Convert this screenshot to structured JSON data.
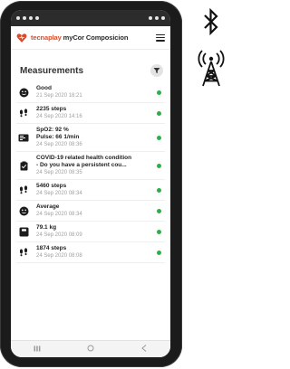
{
  "app": {
    "title_brand": "tecnaplay",
    "title_rest": " myCor Composicion",
    "logo_icon": "heart-icon",
    "brand_color": "#d94c2a"
  },
  "section": {
    "title": "Measurements",
    "filter_icon": "filter-icon"
  },
  "status_color_ok": "#2eae4a",
  "measurements": [
    {
      "icon": "mood-face-icon",
      "lines": [
        "Good"
      ],
      "date": "21 Sep 2020 18:21"
    },
    {
      "icon": "footsteps-icon",
      "lines": [
        "2235 steps"
      ],
      "date": "24 Sep 2020 14:16"
    },
    {
      "icon": "pulse-oximeter-icon",
      "lines": [
        "SpO2: 92 %",
        "Pulse: 66 1/min"
      ],
      "date": "24 Sep 2020 08:36"
    },
    {
      "icon": "clipboard-icon",
      "lines": [
        "COVID-19 related health condition",
        "- Do you have a persistent cou..."
      ],
      "date": "24 Sep 2020 08:35"
    },
    {
      "icon": "footsteps-icon",
      "lines": [
        "5460 steps"
      ],
      "date": "24 Sep 2020 08:34"
    },
    {
      "icon": "mood-face-icon",
      "lines": [
        "Average"
      ],
      "date": "24 Sep 2020 08:34"
    },
    {
      "icon": "weight-scale-icon",
      "lines": [
        "79.1 kg"
      ],
      "date": "24 Sep 2020 08:09"
    },
    {
      "icon": "footsteps-icon",
      "lines": [
        "1874 steps"
      ],
      "date": "24 Sep 2020 08:08"
    }
  ],
  "side_icons": [
    "bluetooth-icon",
    "cell-tower-icon"
  ],
  "navbar": [
    "recent-apps-icon",
    "home-icon",
    "back-icon"
  ]
}
